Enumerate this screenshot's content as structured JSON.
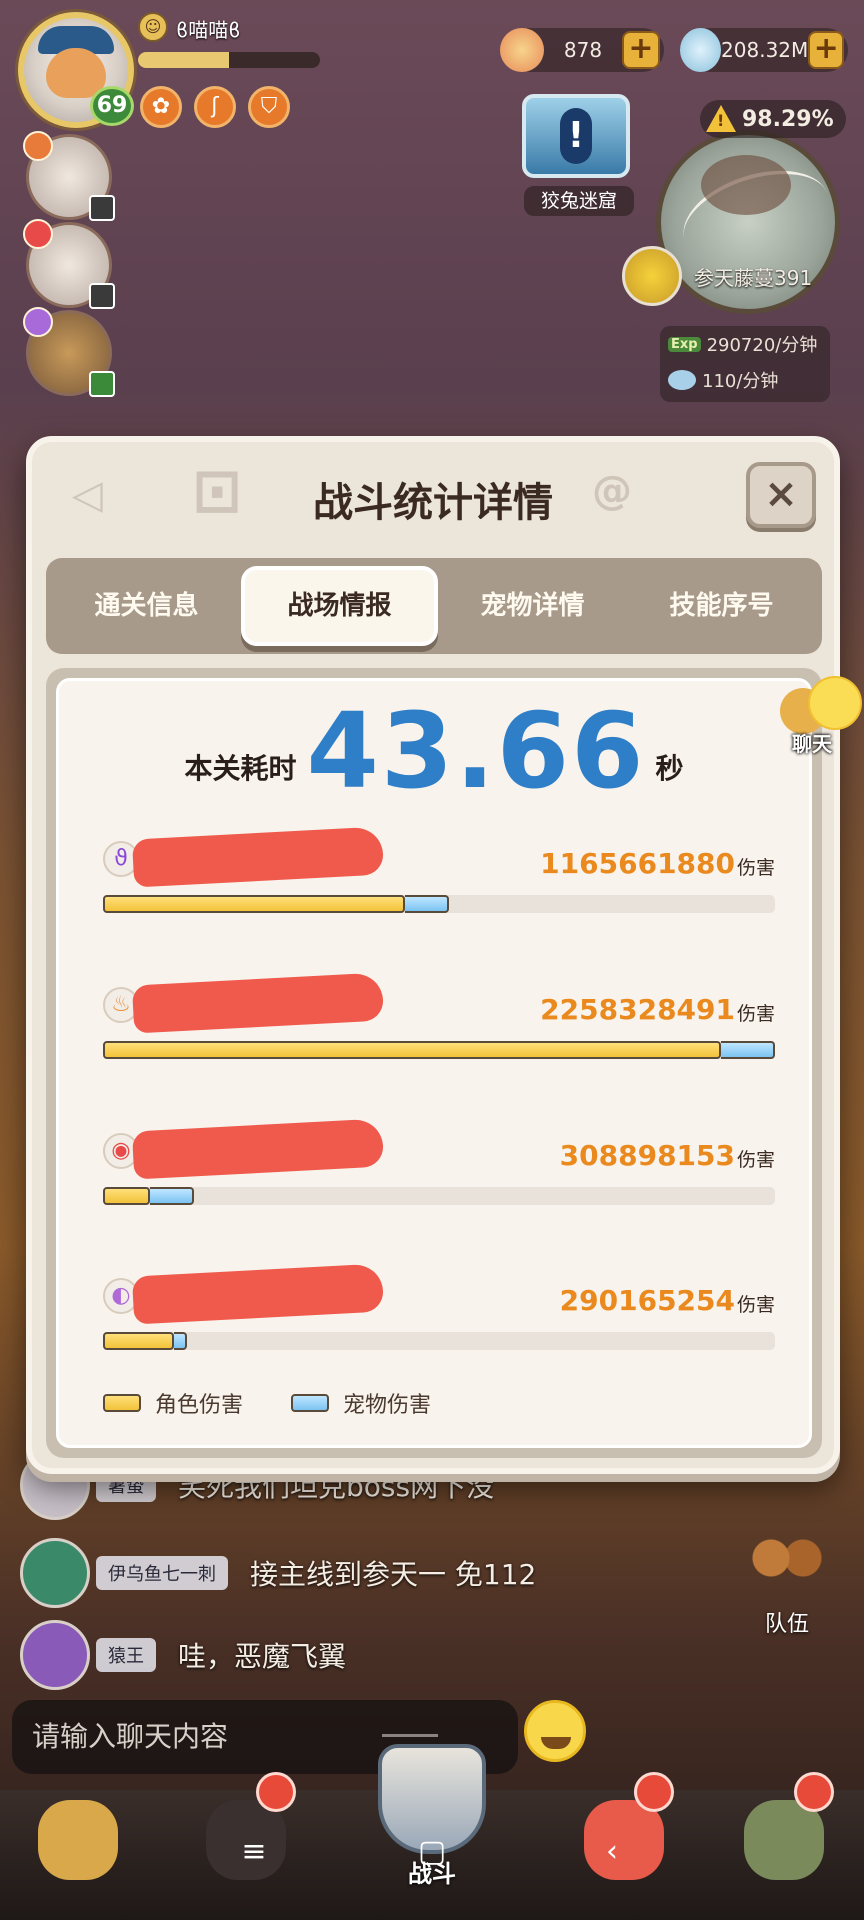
{
  "hud": {
    "player_name": "ϐ喵喵ϐ",
    "player_level": "69",
    "exp_progress": 0.5,
    "currency_gold": "878",
    "currency_shell": "208.32M",
    "plus_label": "+",
    "cave_label": "狡兔迷窟",
    "exploration_percent": "98.29%",
    "location_name": "参天藤蔓391",
    "exp_rate": "290720/分钟",
    "shell_rate": "110/分钟",
    "exp_tag": "Exp"
  },
  "modal": {
    "title": "战斗统计详情",
    "close_label": "×",
    "tabs": [
      {
        "label": "通关信息",
        "active": false
      },
      {
        "label": "战场情报",
        "active": true
      },
      {
        "label": "宠物详情",
        "active": false
      },
      {
        "label": "技能序号",
        "active": false
      }
    ],
    "time_label": "本关耗时",
    "time_value": "43.66",
    "time_unit": "秒",
    "damage_unit": "伤害",
    "legend": {
      "character": "角色伤害",
      "pet": "宠物伤害"
    }
  },
  "chart_data": {
    "type": "bar",
    "orientation": "horizontal",
    "stacked": true,
    "categories": [
      "",
      "",
      "",
      ""
    ],
    "totals_labels": [
      "1165661880",
      "2258328491",
      "308898153",
      "290165254"
    ],
    "totals": [
      1165661880,
      2258328491,
      308898153,
      290165254
    ],
    "series": [
      {
        "name": "角色伤害",
        "color": "#f2c23a",
        "fractions": [
          0.45,
          0.92,
          0.07,
          0.105
        ]
      },
      {
        "name": "宠物伤害",
        "color": "#7cc3f2",
        "fractions": [
          0.065,
          0.08,
          0.065,
          0.02
        ]
      }
    ],
    "xlim_fraction": [
      0,
      1
    ],
    "legend_position": "bottom-left",
    "class_icons": [
      "ϑ",
      "♨",
      "◉",
      "◐"
    ],
    "class_icon_colors": [
      "#8a4ad8",
      "#e8903a",
      "#e84a4a",
      "#b06ad8"
    ]
  },
  "chat_float": {
    "label": "聊天"
  },
  "chat": {
    "messages": [
      {
        "name": "暑蛰",
        "text": "笑死我们坦克boss网下没"
      },
      {
        "name": "伊乌鱼七一刺",
        "text": "接主线到参天一 免112"
      },
      {
        "name": "猿王",
        "text": "哇，恶魔飞翼"
      }
    ],
    "input_placeholder": "请输入聊天内容",
    "team_label": "队伍"
  },
  "nav": {
    "battle_label": "战斗",
    "sys_menu": "≡",
    "sys_home": "▢",
    "sys_back": "‹"
  }
}
